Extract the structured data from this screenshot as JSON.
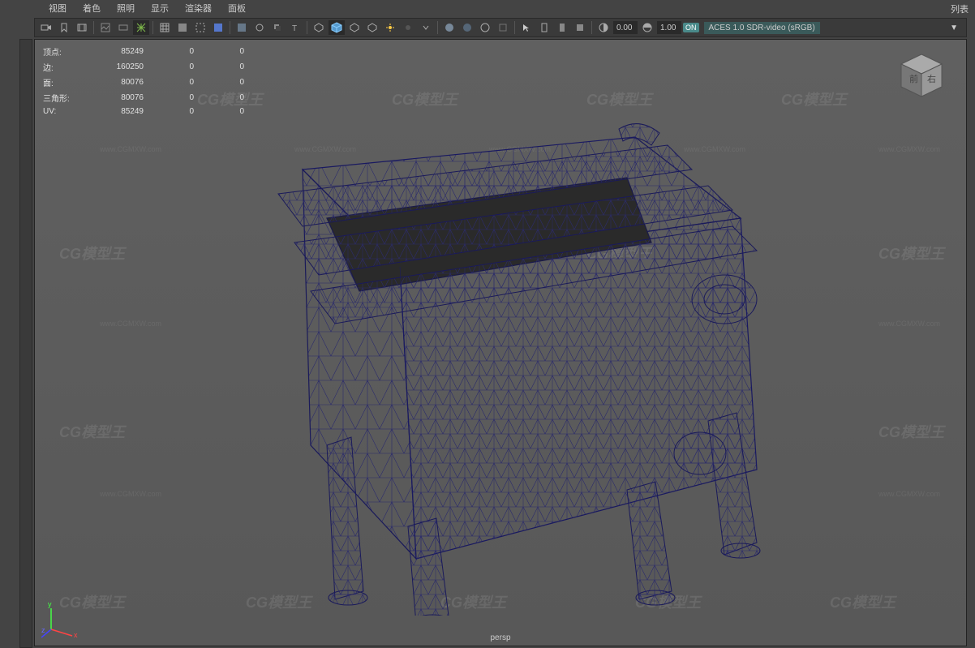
{
  "menu": {
    "items": [
      "视图",
      "着色",
      "照明",
      "显示",
      "渲染器",
      "面板"
    ]
  },
  "right_panel_label": "列表",
  "toolbar": {
    "num1": "0.00",
    "num2": "1.00",
    "on_badge": "ON",
    "colorspace": "ACES 1.0 SDR-video (sRGB)"
  },
  "hud": {
    "rows": [
      {
        "label": "顶点:",
        "v1": "85249",
        "v2": "0",
        "v3": "0"
      },
      {
        "label": "边:",
        "v1": "160250",
        "v2": "0",
        "v3": "0"
      },
      {
        "label": "面:",
        "v1": "80076",
        "v2": "0",
        "v3": "0"
      },
      {
        "label": "三角形:",
        "v1": "80076",
        "v2": "0",
        "v3": "0"
      },
      {
        "label": "UV:",
        "v1": "85249",
        "v2": "0",
        "v3": "0"
      }
    ]
  },
  "viewcube": {
    "front": "前",
    "right": "右"
  },
  "camera": "persp",
  "watermark": {
    "main": "CG模型王",
    "sub": "www.CGMXW.com"
  },
  "axis": {
    "x": "x",
    "y": "y",
    "z": "z"
  }
}
